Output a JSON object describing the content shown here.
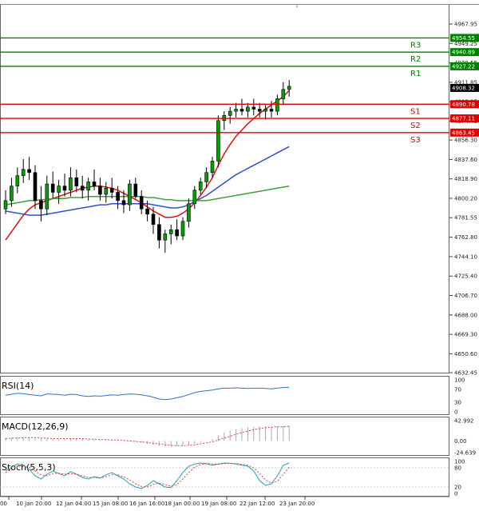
{
  "chart_data": {
    "type": "candlestick",
    "x_ticks": [
      "00",
      "10 Jan 20:00",
      "12 Jan 04:00",
      "15 Jan 08:00",
      "16 Jan 16:00",
      "18 Jan 00:00",
      "19 Jan 08:00",
      "22 Jan 12:00",
      "23 Jan 20:00"
    ],
    "y_ticks": [
      4967.95,
      4949.25,
      4930.55,
      4911.85,
      4893.15,
      4874.45,
      4856.3,
      4837.6,
      4818.9,
      4800.2,
      4781.55,
      4762.8,
      4744.1,
      4725.4,
      4706.7,
      4688.0,
      4669.3,
      4650.6,
      4632.45
    ],
    "ylim": [
      4632.45,
      4967.95
    ],
    "current_price": "4908.32",
    "levels": [
      {
        "name": "R3",
        "value": 4954.55,
        "label": "4954.55",
        "color": "#008000"
      },
      {
        "name": "R2",
        "value": 4940.89,
        "label": "4940.89",
        "color": "#008000"
      },
      {
        "name": "R1",
        "value": 4927.22,
        "label": "4927.22",
        "color": "#008000"
      },
      {
        "name": "S1",
        "value": 4890.78,
        "label": "4890.78",
        "color": "#e00000"
      },
      {
        "name": "S2",
        "value": 4877.11,
        "label": "4877.11",
        "color": "#e00000"
      },
      {
        "name": "S3",
        "value": 4863.45,
        "label": "4863.45",
        "color": "#e00000"
      }
    ],
    "candles": [
      [
        4790,
        4808,
        4785,
        4798
      ],
      [
        4798,
        4820,
        4792,
        4812
      ],
      [
        4812,
        4830,
        4805,
        4822
      ],
      [
        4822,
        4838,
        4815,
        4828
      ],
      [
        4828,
        4840,
        4818,
        4825
      ],
      [
        4825,
        4832,
        4790,
        4798
      ],
      [
        4798,
        4812,
        4778,
        4790
      ],
      [
        4790,
        4822,
        4784,
        4814
      ],
      [
        4814,
        4826,
        4800,
        4806
      ],
      [
        4806,
        4818,
        4795,
        4812
      ],
      [
        4812,
        4824,
        4802,
        4808
      ],
      [
        4808,
        4830,
        4802,
        4820
      ],
      [
        4820,
        4828,
        4806,
        4812
      ],
      [
        4812,
        4822,
        4800,
        4808
      ],
      [
        4808,
        4820,
        4798,
        4816
      ],
      [
        4816,
        4828,
        4808,
        4812
      ],
      [
        4812,
        4820,
        4798,
        4804
      ],
      [
        4804,
        4816,
        4796,
        4810
      ],
      [
        4810,
        4820,
        4800,
        4806
      ],
      [
        4806,
        4812,
        4790,
        4798
      ],
      [
        4798,
        4808,
        4786,
        4794
      ],
      [
        4794,
        4818,
        4788,
        4814
      ],
      [
        4814,
        4820,
        4800,
        4802
      ],
      [
        4802,
        4808,
        4785,
        4790
      ],
      [
        4790,
        4798,
        4778,
        4785
      ],
      [
        4785,
        4792,
        4766,
        4775
      ],
      [
        4775,
        4782,
        4752,
        4760
      ],
      [
        4760,
        4770,
        4748,
        4766
      ],
      [
        4766,
        4775,
        4756,
        4770
      ],
      [
        4770,
        4780,
        4760,
        4764
      ],
      [
        4764,
        4782,
        4760,
        4778
      ],
      [
        4778,
        4800,
        4772,
        4795
      ],
      [
        4795,
        4812,
        4790,
        4808
      ],
      [
        4808,
        4820,
        4804,
        4816
      ],
      [
        4816,
        4830,
        4810,
        4825
      ],
      [
        4825,
        4840,
        4820,
        4836
      ],
      [
        4836,
        4880,
        4830,
        4875
      ],
      [
        4875,
        4884,
        4866,
        4880
      ],
      [
        4880,
        4888,
        4872,
        4884
      ],
      [
        4884,
        4892,
        4878,
        4886
      ],
      [
        4886,
        4896,
        4880,
        4884
      ],
      [
        4884,
        4892,
        4878,
        4888
      ],
      [
        4888,
        4896,
        4880,
        4886
      ],
      [
        4886,
        4892,
        4878,
        4884
      ],
      [
        4884,
        4890,
        4876,
        4886
      ],
      [
        4886,
        4894,
        4878,
        4884
      ],
      [
        4884,
        4900,
        4880,
        4896
      ],
      [
        4896,
        4912,
        4890,
        4905
      ],
      [
        4905,
        4914,
        4898,
        4908
      ]
    ],
    "ma_series": [
      {
        "color": "#e01010",
        "values": [
          4760,
          4768,
          4776,
          4784,
          4790,
          4794,
          4796,
          4798,
          4800,
          4802,
          4804,
          4806,
          4808,
          4810,
          4811,
          4812,
          4812,
          4811,
          4810,
          4808,
          4805,
          4802,
          4799,
          4796,
          4792,
          4788,
          4785,
          4782,
          4782,
          4783,
          4786,
          4790,
          4796,
          4803,
          4811,
          4820,
          4832,
          4843,
          4852,
          4860,
          4866,
          4872,
          4877,
          4882,
          4886,
          4890,
          4894,
          4898,
          4904
        ]
      },
      {
        "color": "#3050d0",
        "values": [
          4788,
          4787,
          4786,
          4785,
          4784,
          4784,
          4784,
          4785,
          4786,
          4787,
          4788,
          4789,
          4790,
          4791,
          4792,
          4793,
          4794,
          4794,
          4795,
          4795,
          4795,
          4795,
          4795,
          4795,
          4795,
          4794,
          4793,
          4792,
          4791,
          4791,
          4792,
          4794,
          4797,
          4800,
          4803,
          4807,
          4811,
          4815,
          4819,
          4823,
          4826,
          4829,
          4832,
          4835,
          4838,
          4841,
          4844,
          4847,
          4850
        ]
      },
      {
        "color": "#40a040",
        "values": [
          4794,
          4795,
          4796,
          4797,
          4798,
          4798,
          4799,
          4799,
          4800,
          4800,
          4800,
          4801,
          4801,
          4801,
          4802,
          4802,
          4802,
          4802,
          4802,
          4802,
          4802,
          4802,
          4802,
          4802,
          4801,
          4801,
          4800,
          4799,
          4799,
          4798,
          4798,
          4798,
          4798,
          4798,
          4798,
          4799,
          4800,
          4801,
          4802,
          4803,
          4804,
          4805,
          4806,
          4807,
          4808,
          4809,
          4810,
          4811,
          4812
        ]
      }
    ],
    "indicators": [
      {
        "name": "RSI(14)",
        "color": "#3070d0",
        "scale": [
          "100",
          "70",
          "30",
          "0"
        ],
        "ylim": [
          0,
          100
        ],
        "values": [
          52,
          55,
          58,
          57,
          54,
          52,
          50,
          56,
          55,
          54,
          52,
          55,
          54,
          50,
          48,
          50,
          49,
          51,
          53,
          52,
          54,
          56,
          55,
          53,
          50,
          46,
          40,
          38,
          40,
          44,
          48,
          54,
          60,
          64,
          66,
          68,
          72,
          74,
          74,
          75,
          74,
          73,
          74,
          74,
          73,
          72,
          74,
          76,
          77
        ]
      },
      {
        "name": "MACD(12,26,9)",
        "color": "#e04040",
        "scale": [
          "42.992",
          "0.00",
          "-24.639"
        ],
        "ylim": [
          -24.639,
          42.992
        ],
        "hist": [
          6,
          7,
          8,
          8,
          7,
          5,
          4,
          5,
          5,
          4,
          4,
          5,
          5,
          4,
          3,
          3,
          2,
          2,
          2,
          1,
          0,
          -1,
          -2,
          -4,
          -6,
          -8,
          -10,
          -12,
          -12,
          -11,
          -10,
          -8,
          -6,
          -3,
          0,
          4,
          12,
          18,
          22,
          25,
          27,
          29,
          30,
          31,
          31,
          30,
          31,
          32,
          33
        ],
        "signal": [
          5,
          6,
          6,
          7,
          7,
          7,
          6,
          6,
          5,
          5,
          5,
          5,
          5,
          5,
          4,
          4,
          3,
          3,
          2,
          2,
          1,
          0,
          -1,
          -2,
          -3,
          -5,
          -6,
          -8,
          -9,
          -10,
          -10,
          -9,
          -8,
          -6,
          -4,
          -2,
          2,
          6,
          10,
          14,
          18,
          21,
          24,
          26,
          28,
          29,
          30,
          30,
          31
        ]
      },
      {
        "name": "Stoch(5,5,3)",
        "color": "#20a0c0",
        "scale": [
          "100",
          "80",
          "20",
          "0"
        ],
        "ylim": [
          0,
          100
        ],
        "k": [
          70,
          82,
          92,
          88,
          75,
          55,
          45,
          60,
          70,
          62,
          55,
          68,
          60,
          50,
          45,
          52,
          48,
          58,
          65,
          55,
          45,
          30,
          20,
          15,
          25,
          40,
          30,
          20,
          18,
          40,
          65,
          85,
          92,
          95,
          93,
          88,
          92,
          95,
          94,
          92,
          88,
          85,
          70,
          40,
          25,
          30,
          55,
          88,
          95
        ],
        "d": [
          65,
          75,
          85,
          88,
          82,
          70,
          58,
          55,
          62,
          63,
          60,
          62,
          60,
          55,
          50,
          50,
          48,
          52,
          58,
          58,
          52,
          42,
          30,
          22,
          20,
          28,
          32,
          28,
          22,
          28,
          45,
          65,
          82,
          90,
          93,
          92,
          91,
          93,
          94,
          93,
          91,
          88,
          80,
          62,
          42,
          32,
          38,
          60,
          82
        ]
      }
    ]
  }
}
